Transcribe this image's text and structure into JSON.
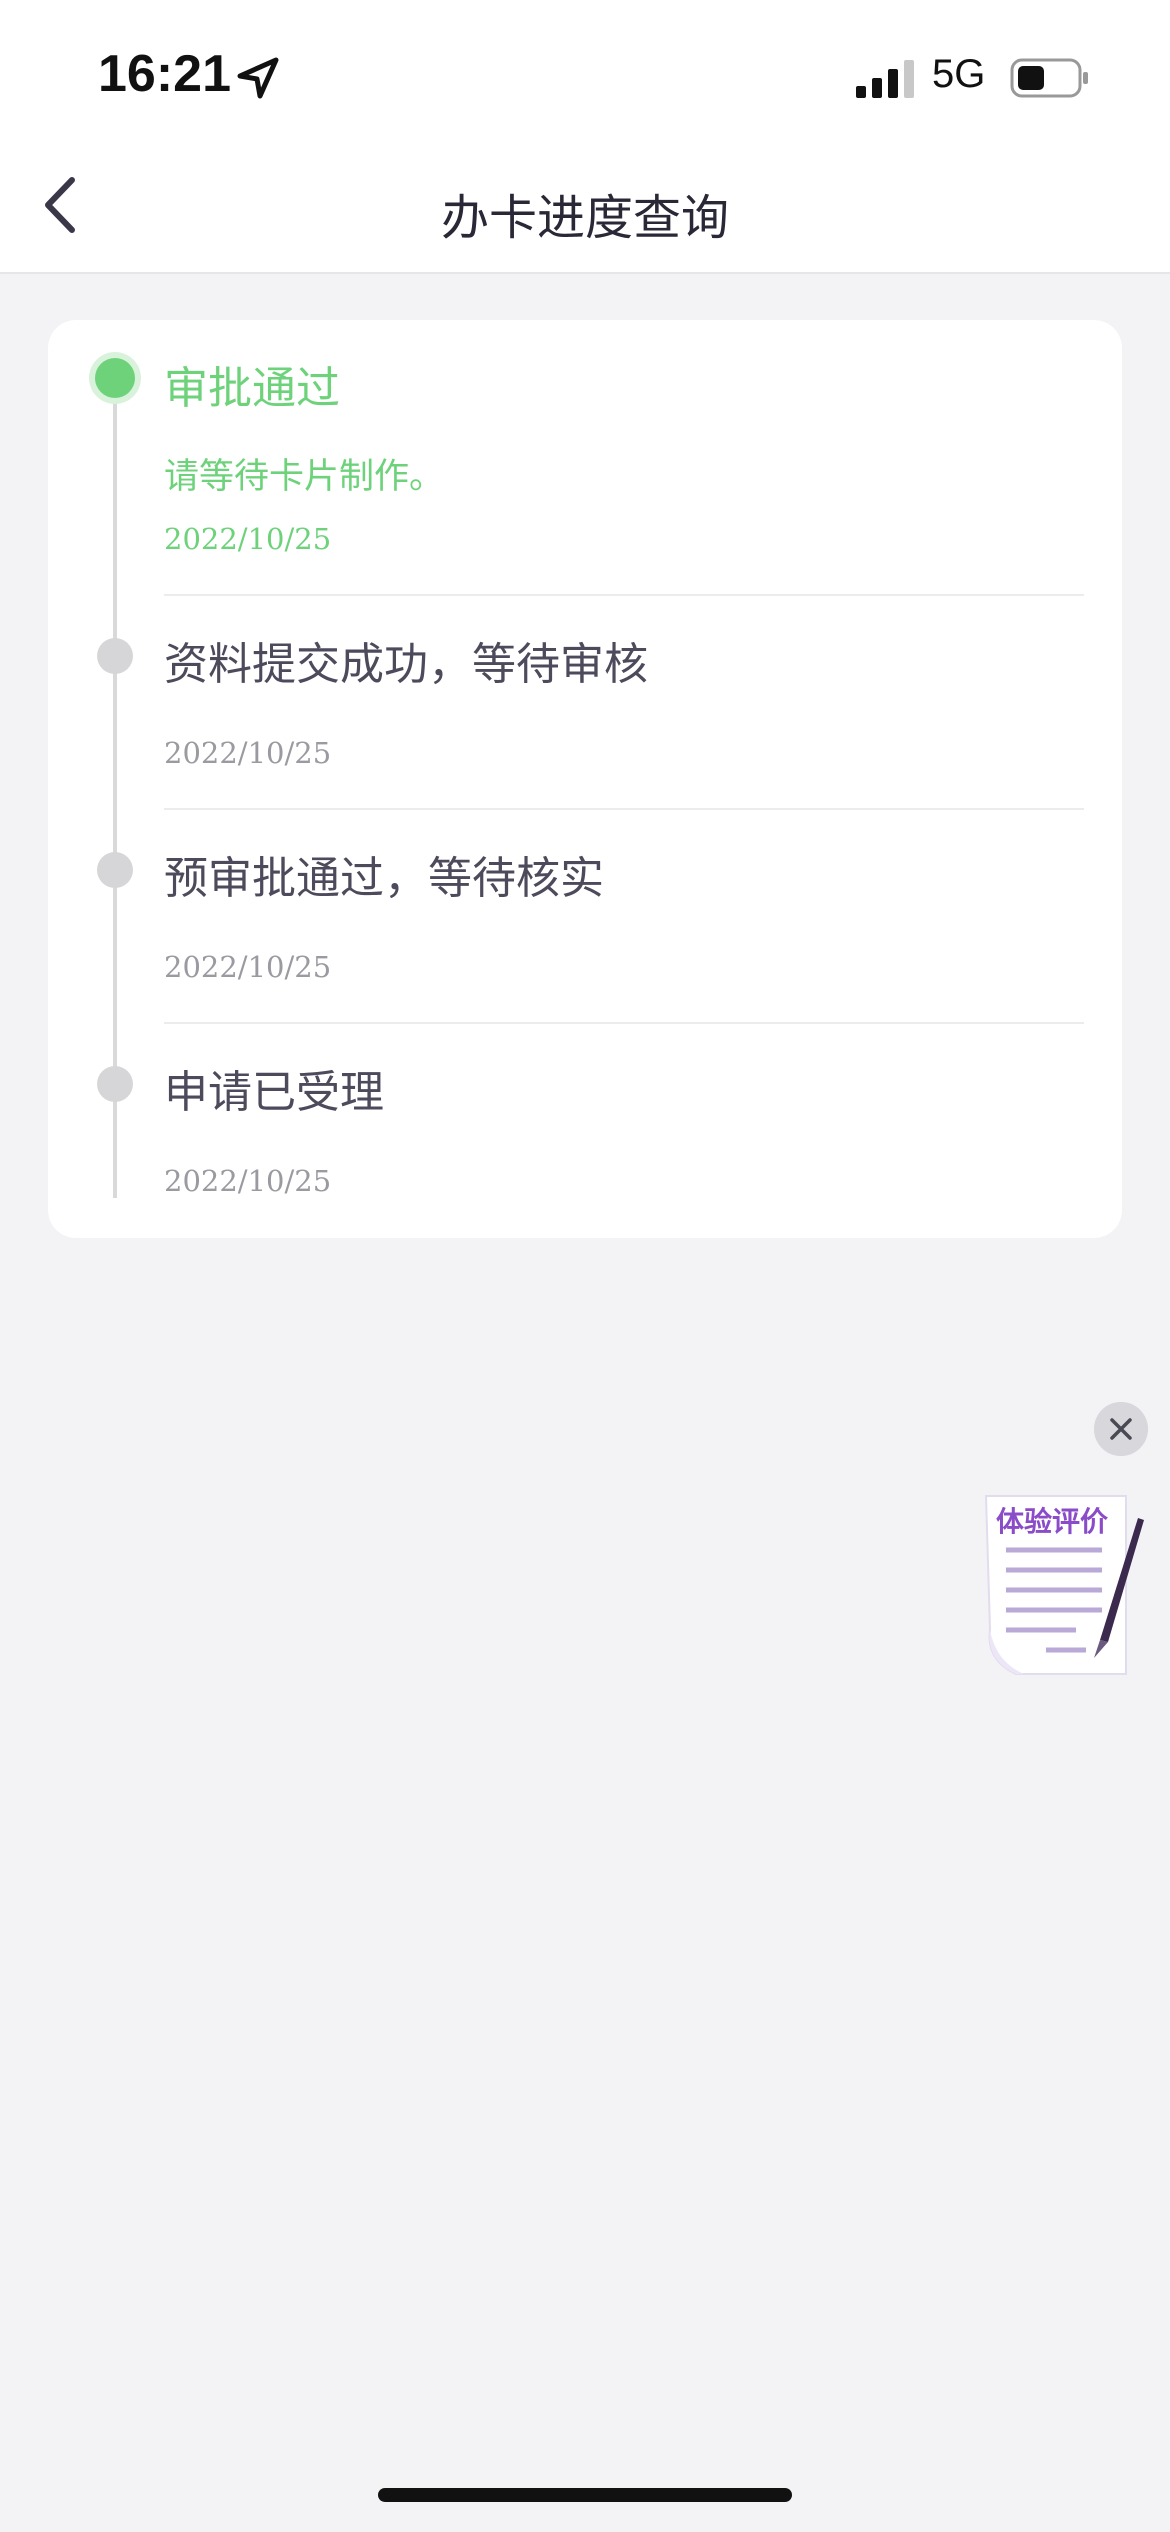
{
  "status_bar": {
    "time": "16:21",
    "network": "5G"
  },
  "header": {
    "title": "办卡进度查询"
  },
  "steps": [
    {
      "title": "审批通过",
      "desc": "请等待卡片制作。",
      "date": "2022/10/25"
    },
    {
      "title": "资料提交成功，等待审核",
      "date": "2022/10/25"
    },
    {
      "title": "预审批通过，等待核实",
      "date": "2022/10/25"
    },
    {
      "title": "申请已受理",
      "date": "2022/10/25"
    }
  ],
  "feedback_float": {
    "label": "体验评价"
  },
  "colors": {
    "active": "#6ed27b",
    "inactive": "#d6d6d8",
    "accent_purple": "#8b4cc8"
  }
}
